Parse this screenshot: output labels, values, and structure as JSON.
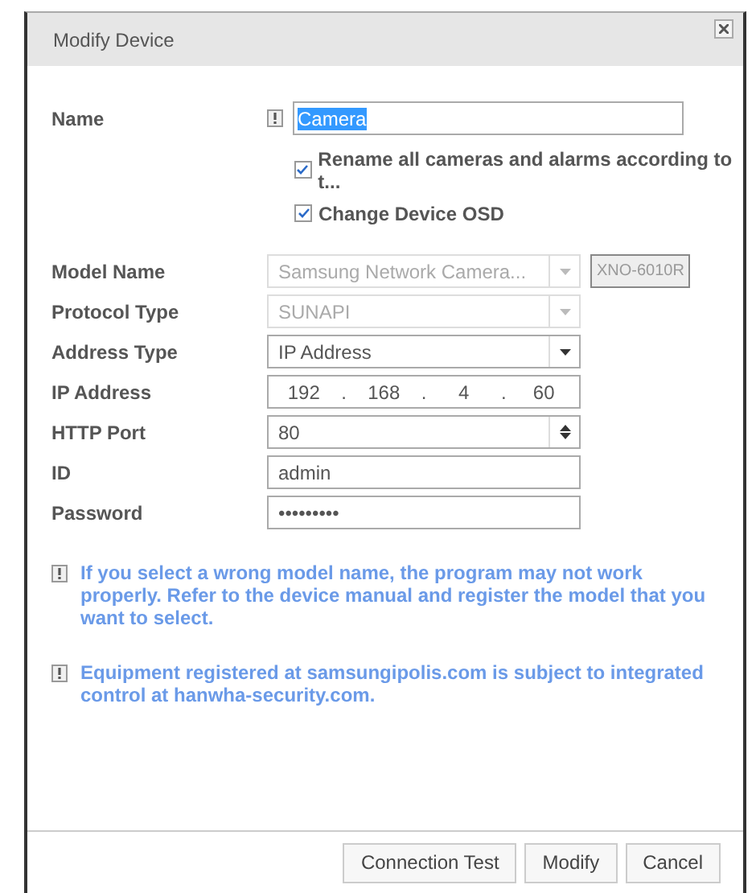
{
  "dialog": {
    "title": "Modify Device"
  },
  "name": {
    "label": "Name",
    "value": "Camera",
    "selected": true
  },
  "options": [
    {
      "label": "Rename all cameras and alarms according to t...",
      "checked": true
    },
    {
      "label": "Change Device OSD",
      "checked": true
    }
  ],
  "fields": [
    {
      "kind": "select",
      "label": "Model Name",
      "value": "Samsung Network Camera...",
      "disabled": true,
      "tag": "XNO-6010R"
    },
    {
      "kind": "select",
      "label": "Protocol Type",
      "value": "SUNAPI",
      "disabled": true
    },
    {
      "kind": "select",
      "label": "Address Type",
      "value": "IP Address",
      "disabled": false
    },
    {
      "kind": "ip",
      "label": "IP Address",
      "octets": [
        "192",
        "168",
        "4",
        "60"
      ],
      "separator": ".",
      "disabled": false
    },
    {
      "kind": "spin",
      "label": "HTTP Port",
      "value": "80",
      "disabled": false
    },
    {
      "kind": "text",
      "label": "ID",
      "value": "admin",
      "disabled": false
    },
    {
      "kind": "password",
      "label": "Password",
      "value": "•••••••••",
      "disabled": false
    }
  ],
  "notes": [
    "If you select a wrong model name, the program may not work properly. Refer to the device manual and register the model that you want to select.",
    "Equipment registered at samsungipolis.com is subject to integrated control at hanwha-security.com."
  ],
  "buttons": [
    "Connection Test",
    "Modify",
    "Cancel"
  ]
}
